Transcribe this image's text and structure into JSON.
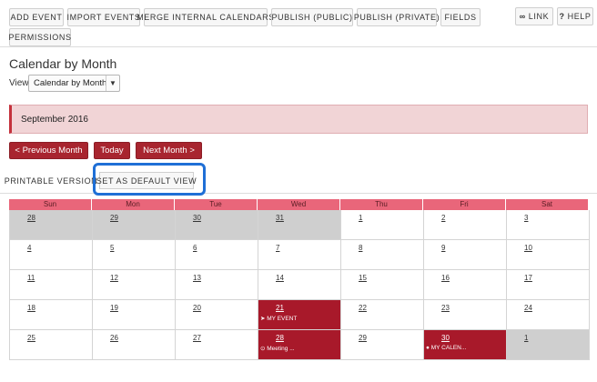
{
  "toolbar": {
    "buttons": [
      "ADD EVENT",
      "IMPORT EVENTS",
      "MERGE INTERNAL CALENDARS",
      "PUBLISH (PUBLIC)",
      "PUBLISH (PRIVATE)",
      "FIELDS",
      "PERMISSIONS"
    ],
    "link_label": "LINK",
    "help_label": "HELP"
  },
  "page_title": "Calendar by Month",
  "view": {
    "label": "View",
    "selected": "Calendar by Month"
  },
  "month_banner": "September 2016",
  "nav": {
    "prev": "< Previous Month",
    "today": "Today",
    "next": "Next Month >"
  },
  "subbar": {
    "printable": "PRINTABLE VERSION",
    "set_default": "SET AS DEFAULT VIEW"
  },
  "calendar": {
    "weekdays": [
      "Sun",
      "Mon",
      "Tue",
      "Wed",
      "Thu",
      "Fri",
      "Sat"
    ],
    "weeks": [
      [
        {
          "day": "28",
          "other": true
        },
        {
          "day": "29",
          "other": true
        },
        {
          "day": "30",
          "other": true
        },
        {
          "day": "31",
          "other": true
        },
        {
          "day": "1"
        },
        {
          "day": "2"
        },
        {
          "day": "3"
        }
      ],
      [
        {
          "day": "4"
        },
        {
          "day": "5"
        },
        {
          "day": "6"
        },
        {
          "day": "7"
        },
        {
          "day": "8"
        },
        {
          "day": "9"
        },
        {
          "day": "10"
        }
      ],
      [
        {
          "day": "11"
        },
        {
          "day": "12"
        },
        {
          "day": "13"
        },
        {
          "day": "14"
        },
        {
          "day": "15"
        },
        {
          "day": "16"
        },
        {
          "day": "17"
        }
      ],
      [
        {
          "day": "18"
        },
        {
          "day": "19"
        },
        {
          "day": "20"
        },
        {
          "day": "21",
          "event": "MY EVENT",
          "event_icon": "➤"
        },
        {
          "day": "22"
        },
        {
          "day": "23"
        },
        {
          "day": "24"
        }
      ],
      [
        {
          "day": "25"
        },
        {
          "day": "26"
        },
        {
          "day": "27"
        },
        {
          "day": "28",
          "event": "Meeting ...",
          "event_icon": "⊙"
        },
        {
          "day": "29"
        },
        {
          "day": "30",
          "event": "MY CALEN...",
          "event_icon": "●"
        },
        {
          "day": "1",
          "other": true
        }
      ]
    ]
  },
  "colors": {
    "accent": "#a8252f",
    "header": "#e9667a",
    "highlight": "#1f6fd6"
  }
}
